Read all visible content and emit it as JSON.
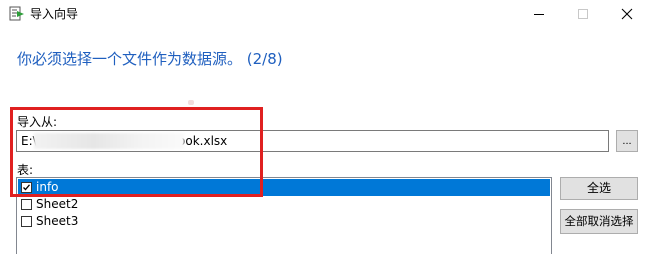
{
  "window": {
    "title": "导入向导",
    "icon": "import-wizard-icon",
    "controls": [
      "minimize-icon",
      "maximize-icon",
      "close-icon"
    ]
  },
  "heading": "你必须选择一个文件作为数据源。 (2/8)",
  "import_from": {
    "label": "导入从:",
    "path_value": "E:\\                              21\\book.xlsx",
    "browse_label": "..."
  },
  "tables": {
    "label": "表:",
    "items": [
      {
        "name": "info",
        "checked": true,
        "selected": true
      },
      {
        "name": "Sheet2",
        "checked": false,
        "selected": false
      },
      {
        "name": "Sheet3",
        "checked": false,
        "selected": false
      }
    ]
  },
  "buttons": {
    "select_all": "全选",
    "deselect_all": "全部取消选择"
  },
  "colors": {
    "heading": "#1f5fbf",
    "selection": "#0078d7",
    "highlight": "#e02020"
  }
}
